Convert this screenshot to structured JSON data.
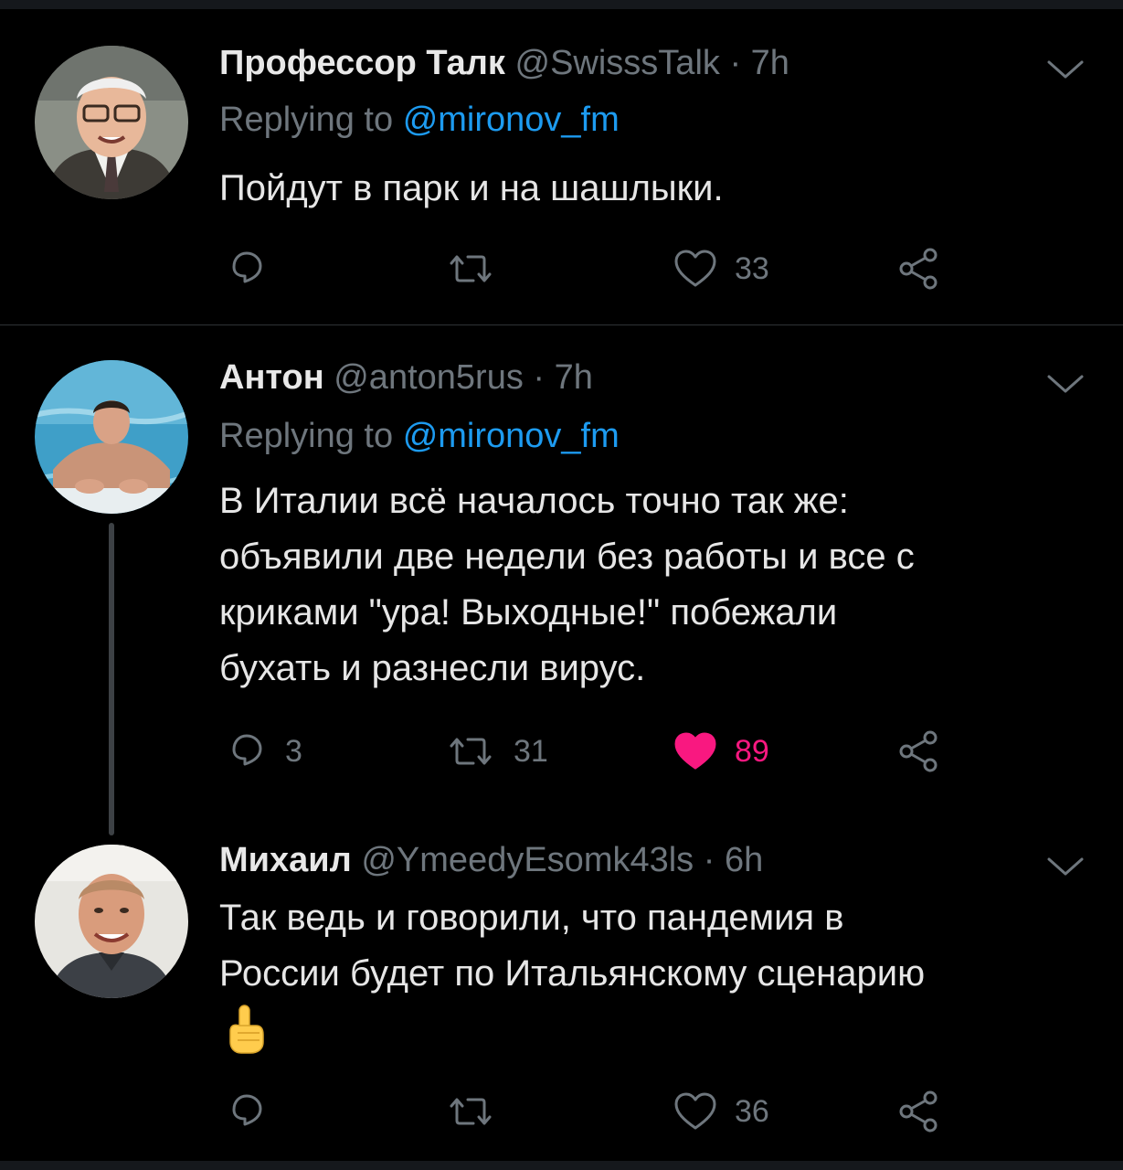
{
  "tweets": [
    {
      "name": "Профессор Талк",
      "handle": "@SwisssTalk",
      "time": "7h",
      "separator": "·",
      "replying_prefix": "Replying to",
      "replying_to": "@mironov_fm",
      "text": "Пойдут в парк и на шашлыки.",
      "reply_count": "",
      "retweet_count": "",
      "like_count": "33",
      "liked": false
    },
    {
      "name": "Антон",
      "handle": "@anton5rus",
      "time": "7h",
      "separator": "·",
      "replying_prefix": "Replying to",
      "replying_to": "@mironov_fm",
      "text_lines": [
        "В Италии всё началось точно так же:",
        "объявили две недели без работы и все с",
        "криками \"ура! Выходные!\" побежали",
        "бухать и разнесли вирус."
      ],
      "reply_count": "3",
      "retweet_count": "31",
      "like_count": "89",
      "liked": true
    },
    {
      "name": "Михаил",
      "handle": "@YmeedyEsomk43ls",
      "time": "6h",
      "separator": "·",
      "text_lines": [
        "Так ведь и говорили, что пандемия в",
        "России будет по Итальянскому сценарию"
      ],
      "emoji": "point-up-emoji",
      "reply_count": "",
      "retweet_count": "",
      "like_count": "36",
      "liked": false
    }
  ],
  "icons": {
    "reply": "reply-icon",
    "retweet": "retweet-icon",
    "like": "heart-icon",
    "share": "share-icon",
    "menu": "chevron-down-icon"
  },
  "colors": {
    "background": "#000000",
    "mention": "#1d9bf0",
    "muted": "#6e767d",
    "like_active": "#f91880"
  }
}
